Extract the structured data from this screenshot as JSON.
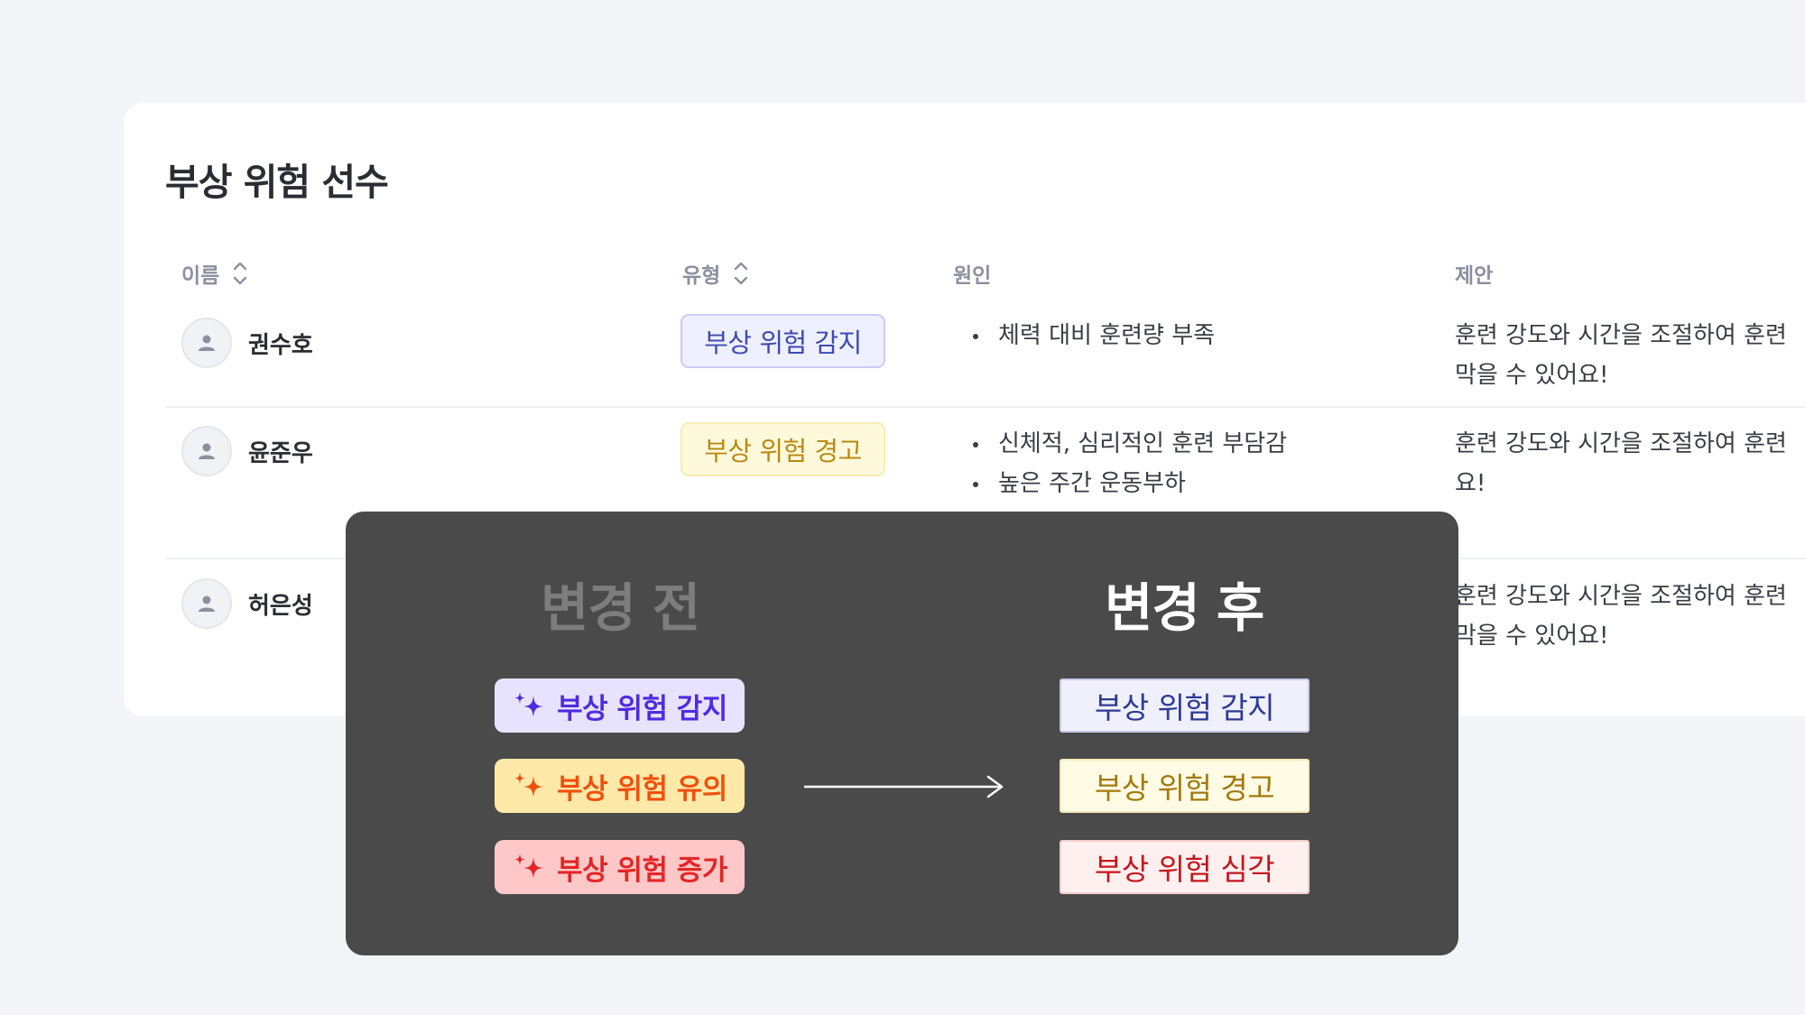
{
  "card": {
    "title": "부상 위험 선수",
    "columns": {
      "name": "이름",
      "type": "유형",
      "cause": "원인",
      "suggestion": "제안"
    },
    "rows": [
      {
        "name": "권수호",
        "type": "부상 위험 감지",
        "causes": [
          "체력 대비 훈련량 부족"
        ],
        "suggestion_lines": [
          "훈련 강도와 시간을 조절하여 훈련",
          "막을 수 있어요!"
        ]
      },
      {
        "name": "윤준우",
        "type": "부상 위험 경고",
        "causes": [
          "신체적, 심리적인 훈련 부담감",
          "높은 주간 운동부하"
        ],
        "suggestion_lines": [
          "훈련 강도와 시간을 조절하여 훈련",
          "요!"
        ]
      },
      {
        "name": "허은성",
        "type": "",
        "causes": [],
        "suggestion_lines": [
          "훈련 강도와 시간을 조절하여 훈련",
          "막을 수 있어요!"
        ]
      }
    ]
  },
  "comparison": {
    "before_title": "변경 전",
    "after_title": "변경 후",
    "before": [
      "부상 위험 감지",
      "부상 위험 유의",
      "부상 위험 증가"
    ],
    "after": [
      "부상 위험 감지",
      "부상 위험 경고",
      "부상 위험 심각"
    ]
  },
  "icons": {
    "sort": "sort-updown-icon",
    "avatar": "user-icon",
    "sparkle": "sparkle-icon",
    "arrow": "arrow-right-icon"
  },
  "colors": {
    "detect": "#4f2bdf",
    "caution": "#f0500e",
    "increase": "#e32626",
    "new_detect": "#2c3a93",
    "new_warn": "#a27a0d",
    "new_severe": "#c4161c"
  }
}
